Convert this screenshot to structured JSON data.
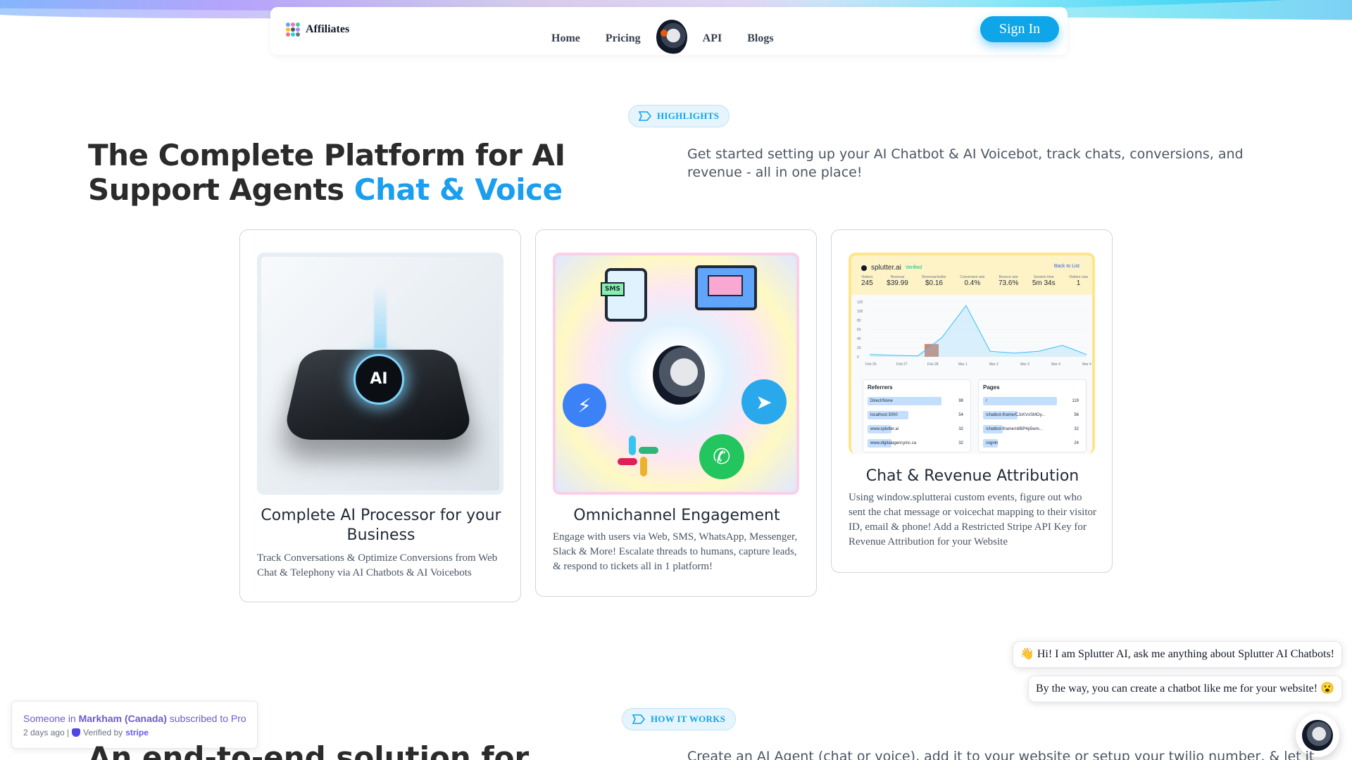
{
  "nav": {
    "brand": "Affiliates",
    "links": [
      "Home",
      "Pricing",
      "API",
      "Blogs"
    ],
    "signin": "Sign In"
  },
  "highlights": {
    "badge": "HIGHLIGHTS",
    "title_main": "The Complete Platform for AI Support Agents ",
    "title_accent": "Chat & Voice",
    "subtitle": "Get started setting up your AI Chatbot & AI Voicebot, track chats, conversions, and revenue - all in one place!"
  },
  "cards": [
    {
      "title": "Complete AI Processor for your Business",
      "desc": "Track Conversations & Optimize Conversions from Web Chat & Telephony via AI Chatbots & AI Voicebots",
      "image_label": "AI"
    },
    {
      "title": "Omnichannel Engagement",
      "desc": "Engage with users via Web, SMS, WhatsApp, Messenger, Slack & More! Escalate threads to humans, capture leads, & respond to tickets all in 1 platform!",
      "image_label": "SMS"
    },
    {
      "title": "Chat & Revenue Attribution",
      "desc": "Using window.splutterai custom events, figure out who sent the chat message or voicechat mapping to their visitor ID, email & phone! Add a Restricted Stripe API Key for Revenue Attribution for your Website",
      "dashboard": {
        "site": "splutter.ai",
        "verified": "Verified",
        "back": "Back to List",
        "stat_labels": [
          "Visitors",
          "Revenue",
          "Revenue/visitor",
          "Conversion rate",
          "Bounce rate",
          "Session time",
          "Visitors now"
        ],
        "stats": [
          "245",
          "$39.99",
          "$0.16",
          "0.4%",
          "73.6%",
          "5m 34s",
          "1"
        ],
        "y_ticks": [
          "120",
          "100",
          "80",
          "60",
          "40",
          "20",
          "0"
        ],
        "x_ticks": [
          "Feb 26",
          "Feb 27",
          "Feb 28",
          "Mar 1",
          "Mar 2",
          "Mar 3",
          "Mar 4",
          "Mar 4"
        ],
        "line_values": [
          5,
          3,
          2,
          42,
          112,
          12,
          8,
          12,
          25,
          5
        ],
        "bar_value": 28,
        "referrers_title": "Referrers",
        "referrers": [
          [
            "Direct/None",
            "98"
          ],
          [
            "localhost:3000",
            "54"
          ],
          [
            "www.splutter.ai",
            "32"
          ],
          [
            "www.digitalagencyinc.ca",
            "32"
          ]
        ],
        "pages_title": "Pages",
        "pages": [
          [
            "/",
            "119"
          ],
          [
            "/chatbot-iframe/CJcKVxSMOy...",
            "56"
          ],
          [
            "/chatbot-iframe/n8BP4p5wm...",
            "32"
          ],
          [
            "/signin",
            "24"
          ]
        ]
      }
    }
  ],
  "chat": {
    "bubble1": "👋 Hi! I am Splutter AI, ask me anything about Splutter AI Chatbots!",
    "bubble2": "By the way, you can create a chatbot like me for your website! 😮"
  },
  "toast": {
    "prefix": "Someone in ",
    "location": "Markham (Canada)",
    "suffix": " subscribed to Pro",
    "time": "2 days ago |",
    "verified": "Verified by",
    "provider": "stripe"
  },
  "how": {
    "badge": "HOW IT WORKS",
    "title": "An end-to-end solution for",
    "subtitle": "Create an AI Agent (chat or voice), add it to your website or setup your twilio number, & let it"
  },
  "colors": {
    "accent": "#1a9ef0",
    "signin": "#0ea5e9"
  }
}
